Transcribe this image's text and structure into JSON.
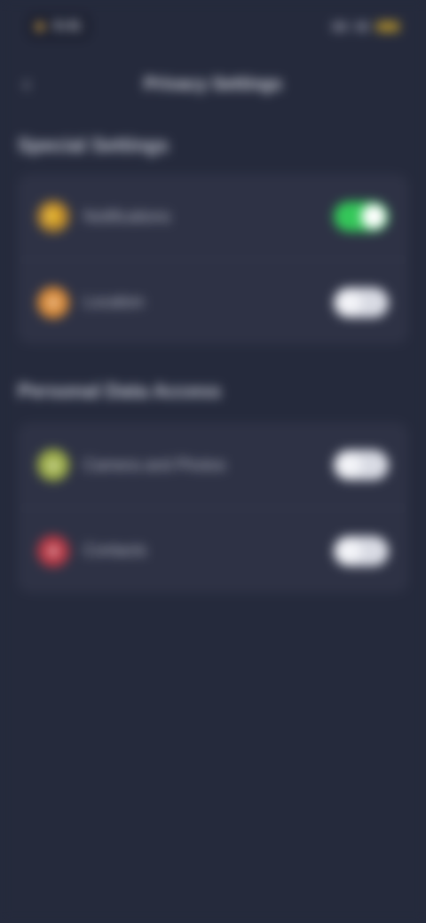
{
  "status_bar": {
    "time": "9:41",
    "signal_icon": "signal-icon",
    "wifi_icon": "wifi-icon",
    "battery_icon": "battery-icon"
  },
  "nav": {
    "back_icon": "‹",
    "title": "Privacy Settings"
  },
  "sections": [
    {
      "title": "Special Settings",
      "items": [
        {
          "label": "Notifications",
          "icon": "bell-icon",
          "icon_glyph": "🔔",
          "icon_color": "#b8862f",
          "toggle": true
        },
        {
          "label": "Location",
          "icon": "location-icon",
          "icon_glyph": "●",
          "icon_color": "#d98b3a",
          "toggle": false
        }
      ]
    },
    {
      "title": "Personal Data Access",
      "items": [
        {
          "label": "Camera and Photos",
          "icon": "camera-icon",
          "icon_glyph": "●",
          "icon_color": "#9fb04a",
          "toggle": false
        },
        {
          "label": "Contacts",
          "icon": "contacts-icon",
          "icon_glyph": "●",
          "icon_color": "#b83a46",
          "toggle": false
        }
      ]
    }
  ]
}
